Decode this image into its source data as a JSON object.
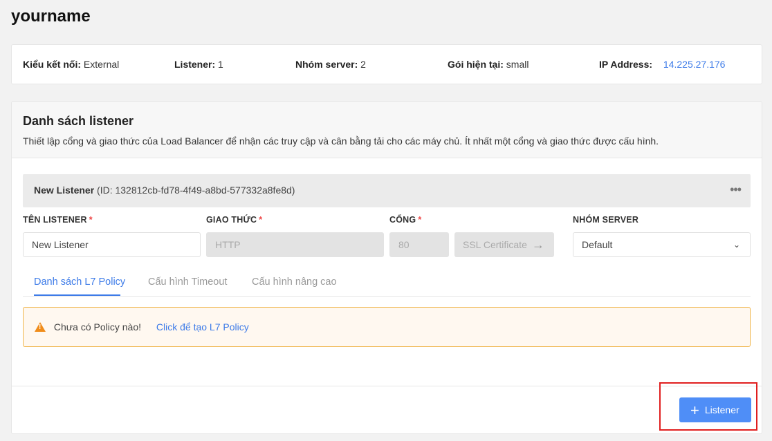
{
  "page": {
    "title": "yourname"
  },
  "summary": {
    "conn_type_label": "Kiểu kết nối:",
    "conn_type_value": "External",
    "listener_label": "Listener:",
    "listener_value": "1",
    "server_group_label": "Nhóm server:",
    "server_group_value": "2",
    "plan_label": "Gói hiện tại:",
    "plan_value": "small",
    "ip_label": "IP Address:",
    "ip_value": "14.225.27.176"
  },
  "listener_section": {
    "title": "Danh sách listener",
    "description": "Thiết lập cổng và giao thức của Load Balancer để nhận các truy cập và cân bằng tải cho các máy chủ. Ít nhất một cổng và giao thức được cấu hình."
  },
  "listener": {
    "name": "New Listener",
    "id_text": "(ID: 132812cb-fd78-4f49-a8bd-577332a8fe8d)",
    "more_icon": "ellipsis-icon"
  },
  "form": {
    "name_label": "TÊN LISTENER",
    "protocol_label": "GIAO THỨC",
    "port_label": "CỔNG",
    "server_group_label": "NHÓM SERVER",
    "required_mark": "*",
    "name_value": "New Listener",
    "protocol_value": "HTTP",
    "port_value": "80",
    "ssl_label": "SSL Certificate",
    "server_group_value": "Default"
  },
  "tabs": [
    {
      "label": "Danh sách L7 Policy",
      "active": true
    },
    {
      "label": "Cấu hình Timeout",
      "active": false
    },
    {
      "label": "Cấu hình nâng cao",
      "active": false
    }
  ],
  "alert": {
    "message": "Chưa có Policy nào!",
    "link": "Click để tạo L7 Policy"
  },
  "actions": {
    "add_listener_label": "Listener"
  },
  "colors": {
    "accent": "#3d7be8",
    "button": "#4f8ef7",
    "warning": "#f08c1a",
    "highlight": "#e01e1e"
  }
}
